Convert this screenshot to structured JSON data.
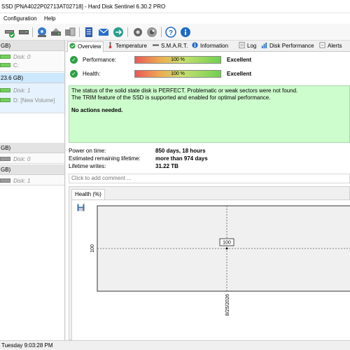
{
  "window": {
    "title": "SSD [PNA4022P02713AT02718]  -  Hard Disk Sentinel 6.30.2 PRO"
  },
  "menu": {
    "configuration": "Configuration",
    "help": "Help"
  },
  "toolbar": {
    "icons": [
      "disk-check-icon",
      "disk-icon",
      "drive-scan-icon",
      "surface-test-icon",
      "tools-icon",
      "report-icon",
      "email-icon",
      "send-report-icon",
      "settings-icon",
      "alerts-icon",
      "help-icon",
      "info-icon"
    ]
  },
  "sidebar": {
    "disks": [
      {
        "size": "GB)",
        "disk_label": "Disk: 0",
        "volume": "C:",
        "bar": "green"
      },
      {
        "size": "23.6 GB)",
        "disk_label": "Disk: 1",
        "volume": "D: [New Volume]",
        "bar": "green"
      },
      {
        "size": "GB)",
        "disk_label": "Disk: 0",
        "bar": "gray"
      },
      {
        "size": "GB)",
        "disk_label": "Disk: 1",
        "bar": "gray"
      }
    ]
  },
  "tabs": {
    "overview": "Overview",
    "temperature": "Temperature",
    "smart": "S.M.A.R.T.",
    "information": "Information",
    "log": "Log",
    "disk_performance": "Disk Performance",
    "alerts": "Alerts"
  },
  "overview": {
    "performance": {
      "label": "Performance:",
      "value": "100 %",
      "percent": 100,
      "rating": "Excellent"
    },
    "health": {
      "label": "Health:",
      "value": "100 %",
      "percent": 100,
      "rating": "Excellent"
    },
    "status": {
      "line1": "The status of the solid state disk is PERFECT. Problematic or weak sectors were not found.",
      "line2": "The TRIM feature of the SSD is supported and enabled for optimal performance.",
      "action": "No actions needed."
    },
    "info": {
      "power_on_label": "Power on time:",
      "power_on_value": "850 days, 18 hours",
      "remaining_label": "Estimated remaining lifetime:",
      "remaining_value": "more than 974 days",
      "writes_label": "Lifetime writes:",
      "writes_value": "31.22 TB"
    },
    "comment_placeholder": "Click to add comment ..."
  },
  "graph": {
    "tab": "Health (%)",
    "save_icon": "save-icon",
    "chart_data": {
      "type": "line",
      "x": [
        "8/25/2026"
      ],
      "values": [
        100
      ],
      "data_labels": [
        "100"
      ],
      "y_ticks": [
        "100"
      ]
    }
  },
  "statusbar": {
    "text": "Tuesday 9:03:28 PM"
  },
  "colors": {
    "status_bg": "#cdfccd",
    "accent": "#0078d7",
    "selection": "#cce8ff"
  }
}
